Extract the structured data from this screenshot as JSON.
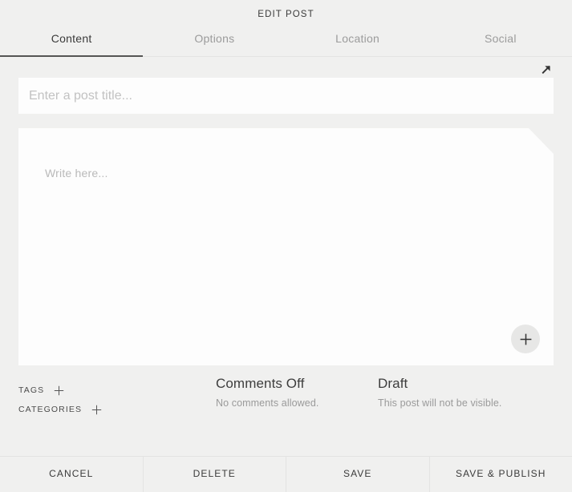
{
  "header": {
    "title": "EDIT POST",
    "tabs": [
      {
        "label": "Content",
        "active": true
      },
      {
        "label": "Options",
        "active": false
      },
      {
        "label": "Location",
        "active": false
      },
      {
        "label": "Social",
        "active": false
      }
    ]
  },
  "editor": {
    "title_placeholder": "Enter a post title...",
    "title_value": "",
    "body_placeholder": "Write here...",
    "body_value": "",
    "expand_icon": "arrow-up-right-icon",
    "add_media_icon": "plus-icon"
  },
  "meta": {
    "taxonomy": [
      {
        "label": "TAGS",
        "add_icon": "plus-icon"
      },
      {
        "label": "CATEGORIES",
        "add_icon": "plus-icon"
      }
    ],
    "comments": {
      "heading": "Comments Off",
      "description": "No comments allowed."
    },
    "status": {
      "heading": "Draft",
      "description": "This post will not be visible."
    }
  },
  "actions": [
    {
      "label": "CANCEL"
    },
    {
      "label": "DELETE"
    },
    {
      "label": "SAVE"
    },
    {
      "label": "SAVE & PUBLISH"
    }
  ],
  "colors": {
    "background": "#f0f0ef",
    "panel": "#fdfdfd",
    "text": "#3d3d3d",
    "muted": "#9b9b9b",
    "placeholder": "#c2c2c2",
    "divider": "#e3e3e2",
    "active_underline": "#555554",
    "fab_background": "#e7e7e6"
  }
}
